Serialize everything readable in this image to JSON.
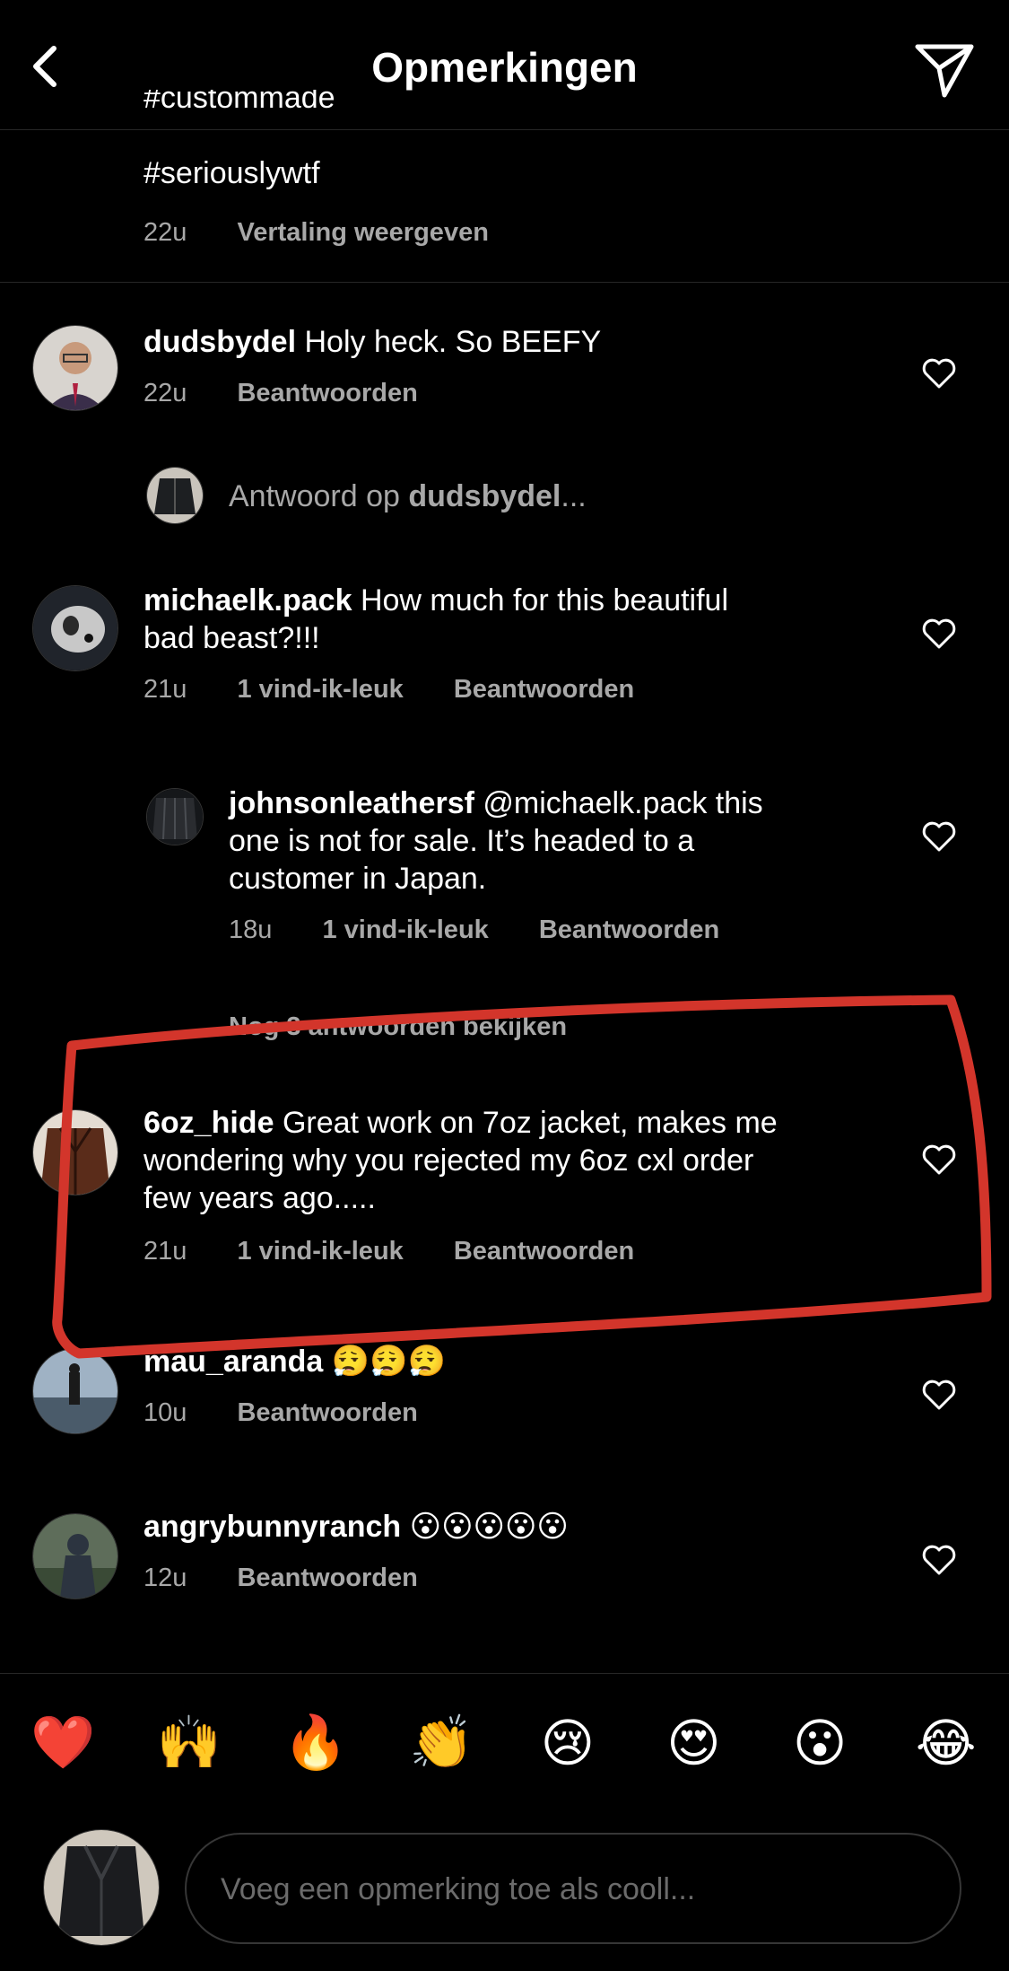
{
  "header": {
    "title": "Opmerkingen"
  },
  "caption": {
    "cut_tag": "#custommade",
    "last_tag": "#seriouslywtf",
    "time": "22u",
    "translate": "Vertaling weergeven"
  },
  "comments": [
    {
      "user": "dudsbydel",
      "text": "Holy heck. So BEEFY",
      "time": "22u",
      "reply": "Beantwoorden"
    },
    {
      "reply_to_prefix": "Antwoord op ",
      "reply_to_user": "dudsbydel",
      "reply_to_suffix": "..."
    },
    {
      "user": "michaelk.pack",
      "text_line1": "How much for this beautiful",
      "text_line2": "bad beast?!!!",
      "time": "21u",
      "likes": "1 vind-ik-leuk",
      "reply": "Beantwoorden"
    },
    {
      "user": "johnsonleathersf",
      "text_line1": "@michaelk.pack this",
      "text_line2": "one is not for sale.  It’s headed to a",
      "text_line3": "customer in Japan.",
      "time": "18u",
      "likes": "1 vind-ik-leuk",
      "reply": "Beantwoorden"
    },
    {
      "view_more": "Nog 3 antwoorden bekijken"
    },
    {
      "user": "6oz_hide",
      "text_line1": "Great work on 7oz jacket, makes me",
      "text_line2": "wondering why you rejected my 6oz cxl order",
      "text_line3": "few years ago.....",
      "time": "21u",
      "likes": "1 vind-ik-leuk",
      "reply": "Beantwoorden"
    },
    {
      "user": "mau_aranda",
      "text": "😮‍💨😮‍💨😮‍💨",
      "time": "10u",
      "reply": "Beantwoorden"
    },
    {
      "user": "angrybunnyranch",
      "text": "😮😮😮😮😮",
      "time": "12u",
      "reply": "Beantwoorden"
    }
  ],
  "emoji_bar": [
    "❤️",
    "🙌",
    "🔥",
    "👏",
    "😢",
    "😍",
    "😮",
    "😂"
  ],
  "composer": {
    "placeholder": "Voeg een opmerking toe als cooll..."
  },
  "colors": {
    "background": "#000000",
    "secondary_text": "#a8a8a8",
    "annotation": "#d3352b"
  }
}
